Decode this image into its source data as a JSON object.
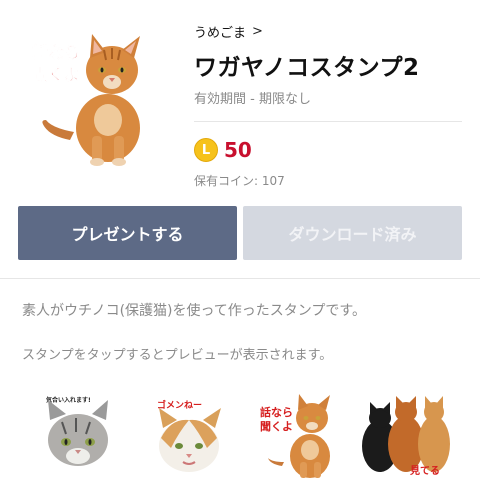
{
  "header": {
    "author": "うめごま",
    "author_chevron": ">",
    "title": "ワガヤノコスタンプ2",
    "period": "有効期間 - 期限なし",
    "coin_letter": "L",
    "price": "50",
    "owned_coins": "保有コイン: 107",
    "main_image_caption": "話なら聞くよ"
  },
  "buttons": {
    "present": "プレゼントする",
    "download": "ダウンロード済み"
  },
  "description": {
    "line1": "素人がウチノコ(保護猫)を使って作ったスタンプです。",
    "line2": "スタンプをタップするとプレビューが表示されます。"
  },
  "stickers": [
    {
      "caption": "気合い入れます!"
    },
    {
      "caption": "ゴメンねー"
    },
    {
      "caption": "話なら聞くよ"
    },
    {
      "caption": "見てる"
    }
  ],
  "colors": {
    "accent_button": "#5d6a86",
    "disabled_button": "#d4d8e0",
    "price": "#c8102e",
    "coin": "#f6c21b"
  }
}
